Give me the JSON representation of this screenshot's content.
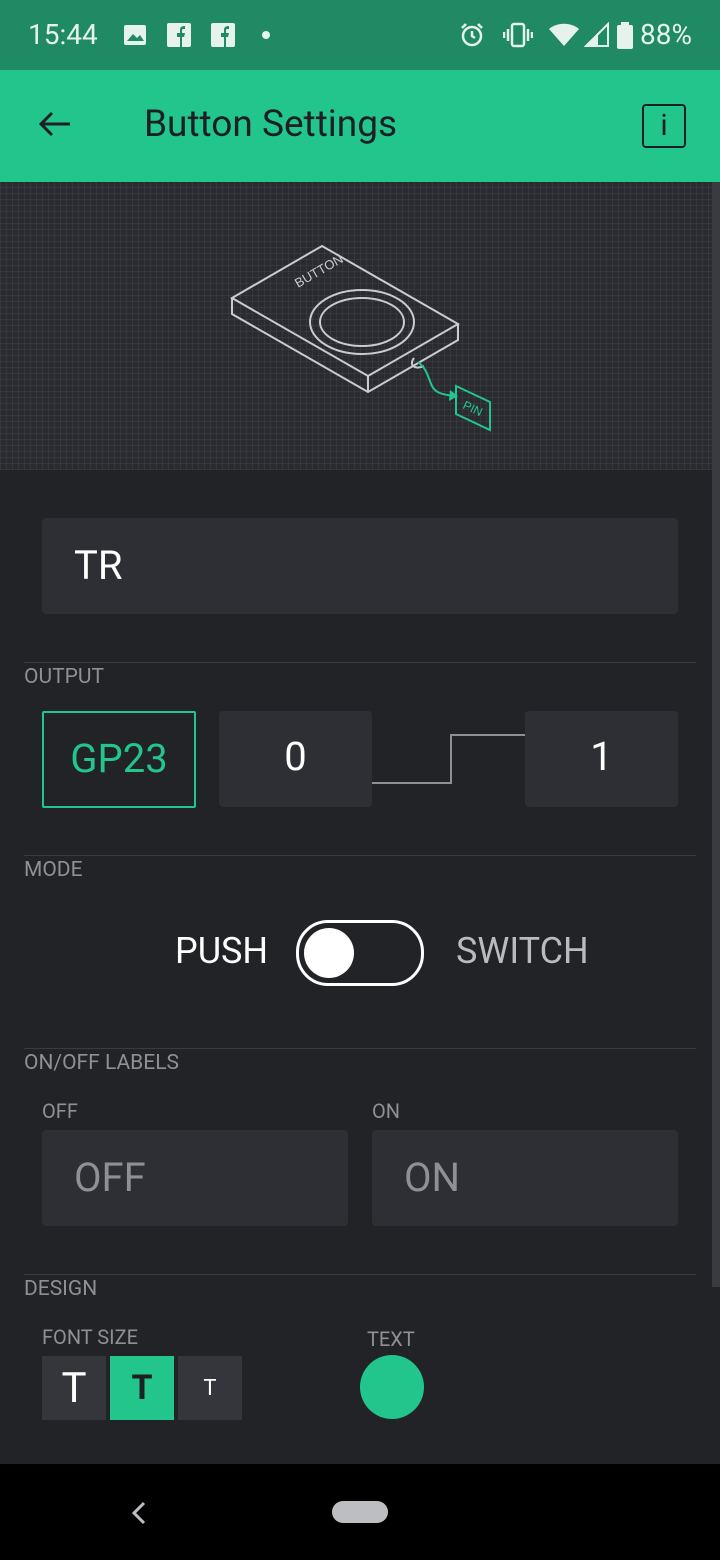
{
  "status_bar": {
    "time": "15:44",
    "battery": "88%"
  },
  "app_bar": {
    "title": "Button Settings",
    "info_label": "i"
  },
  "hero": {
    "device_label": "BUTTON",
    "pin_label": "PIN"
  },
  "name_field": {
    "value": "TR"
  },
  "output": {
    "section_label": "OUTPUT",
    "pin": "GP23",
    "low_value": "0",
    "high_value": "1"
  },
  "mode": {
    "section_label": "MODE",
    "push_label": "PUSH",
    "switch_label": "SWITCH",
    "selected": "PUSH"
  },
  "labels": {
    "section_label": "ON/OFF LABELS",
    "off_label": "OFF",
    "on_label": "ON",
    "off_value": "OFF",
    "on_value": "ON"
  },
  "design": {
    "section_label": "DESIGN",
    "font_size_label": "FONT SIZE",
    "text_color_label": "TEXT",
    "font_sizes": [
      "T",
      "T",
      "T"
    ],
    "selected_font_size": 1,
    "text_color": "#22c58c"
  },
  "colors": {
    "accent": "#22c58c",
    "status": "#1f8a64",
    "background": "#222327"
  }
}
